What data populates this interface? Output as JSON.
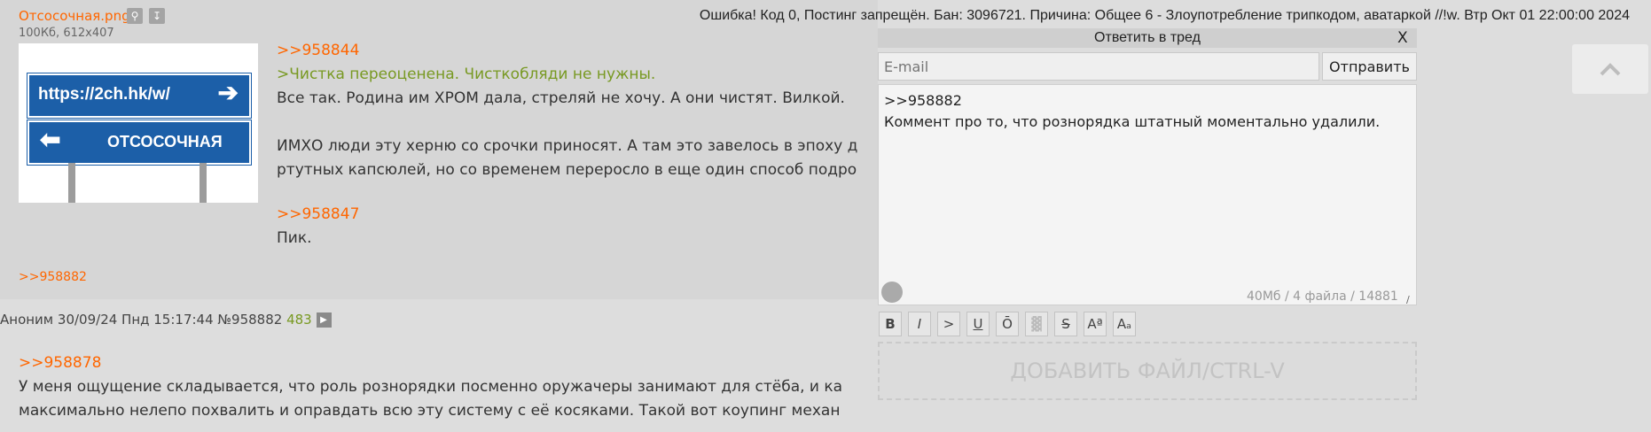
{
  "ban": {
    "text": "Ошибка! Код 0, Постинг запрещён. Бан: 3096721. Причина: Общее 6 - Злоупотребление трипкодом, аватаркой //!w. Втр Окт 01 22:00:00 2024"
  },
  "post1": {
    "file_name": "Отсосочная.png",
    "file_meta": "100Кб, 612x407",
    "thumb_sign_top": "https://2ch.hk/w/",
    "thumb_sign_bottom": "ОТСОСОЧНАЯ",
    "reply1": ">>958844",
    "quote": ">Чистка переоценена. Чисткобляди не нужны.",
    "line1": "Все так. Родина им ХРОМ дала, стреляй не хочу. А они чистят. Вилкой.",
    "line2": "ИМХО люди эту херню со срочки приносят. А там это завелось в эпоху д",
    "line3": "ртутных капсюлей, но со временем переросло в еще один способ подро",
    "reply2": ">>958847",
    "line4": "Пик.",
    "backlink": ">>958882"
  },
  "post2": {
    "author": "Аноним",
    "date": "30/09/24 Пнд 15:17:44",
    "num": "№958882",
    "count": "483",
    "reply": ">>958878",
    "line1": "У меня ощущение складывается, что роль рознорядки посменно оружачеры занимают для стёба, и ка",
    "line2": "максимально нелепо похвалить и оправдать всю эту систему с её косяками. Такой вот коупинг механ"
  },
  "form": {
    "title": "Ответить в тред",
    "close": "X",
    "email_placeholder": "E-mail",
    "submit": "Отправить",
    "text": ">>958882\nКоммент про то, что рознорядка штатный моментально удалили.",
    "stats": "40Мб / 4 файла / 14881",
    "markup": [
      "B",
      "I",
      ">",
      "U",
      "Ō",
      "▓",
      "S",
      "Aª",
      "Aₐ"
    ],
    "dropzone": "ДОБАВИТЬ ФАЙЛ/CTRL-V"
  },
  "icons": {
    "search": "search-icon",
    "download": "download-icon",
    "play": "play-icon",
    "scroll_up": "chevron-up-icon"
  }
}
